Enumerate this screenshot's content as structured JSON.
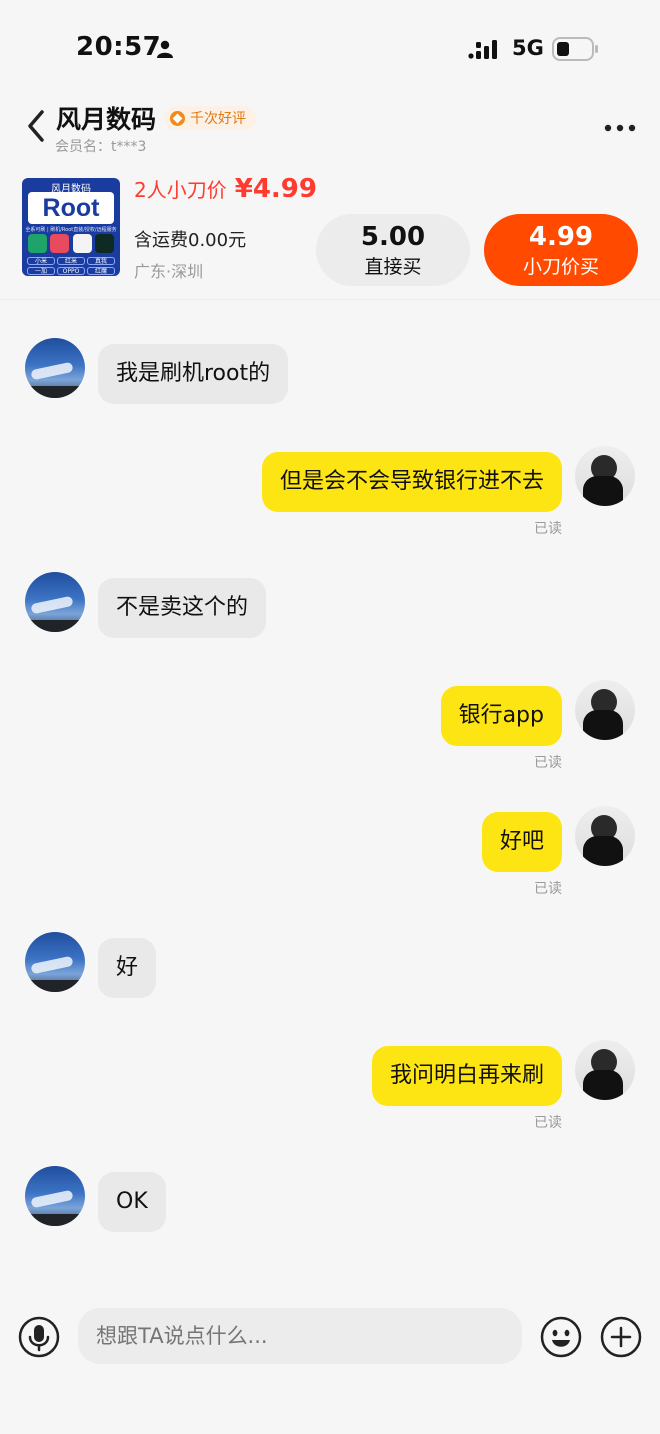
{
  "status_bar": {
    "time": "20:57",
    "network": "5G"
  },
  "header": {
    "shop_name": "风月数码",
    "badge": "千次好评",
    "member": "会员名：t***3"
  },
  "product": {
    "thumb_title": "风月数码",
    "thumb_root": "Root",
    "thumb_sub": "全系可刷 | 刷机/Root直装/授权/远程服务",
    "thumb_tags": [
      "小米",
      "红米",
      "真我",
      "一加",
      "OPPO",
      "红魔"
    ],
    "bargain_label": "2人小刀价",
    "bargain_price": "¥4.99",
    "shipping": "含运费0.00元",
    "location": "广东·深圳",
    "direct_price": "5.00",
    "direct_label": "直接买",
    "bargain_btn_price": "4.99",
    "bargain_btn_label": "小刀价买"
  },
  "messages": [
    {
      "side": "left",
      "text": "我是刷机root的"
    },
    {
      "side": "right",
      "text": "但是会不会导致银行进不去",
      "status": "已读"
    },
    {
      "side": "left",
      "text": "不是卖这个的"
    },
    {
      "side": "right",
      "text": "银行app",
      "status": "已读"
    },
    {
      "side": "right",
      "text": "好吧",
      "status": "已读"
    },
    {
      "side": "left",
      "text": "好"
    },
    {
      "side": "right",
      "text": "我问明白再来刷",
      "status": "已读"
    },
    {
      "side": "left",
      "text": "OK"
    }
  ],
  "input": {
    "placeholder": "想跟TA说点什么..."
  },
  "colors": {
    "accent": "#ff4a00",
    "price": "#ff3b30",
    "my_bubble": "#fde413",
    "their_bubble": "#e9e9ea"
  }
}
